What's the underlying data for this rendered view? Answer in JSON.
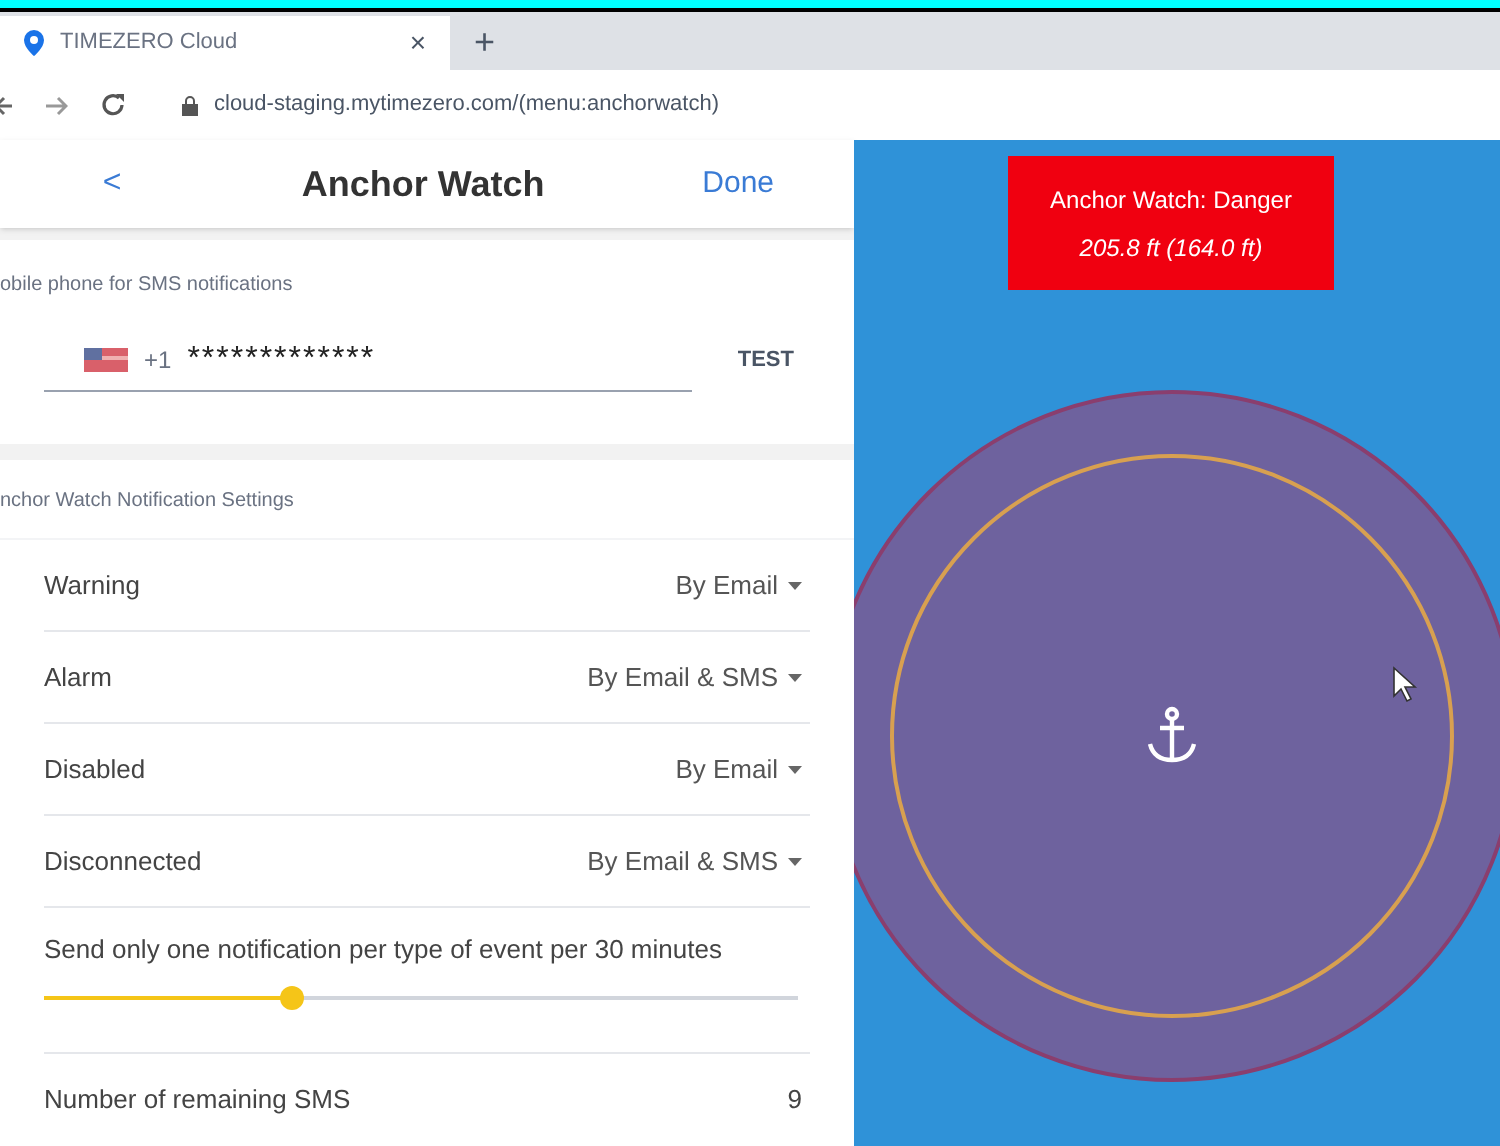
{
  "browser": {
    "tab_title": "TIMEZERO Cloud",
    "tab_close": "×",
    "new_tab": "+",
    "url": "cloud-staging.mytimezero.com/(menu:anchorwatch)"
  },
  "header": {
    "back": "<",
    "title": "Anchor Watch",
    "done": "Done"
  },
  "phone_section": {
    "heading": "obile phone for SMS notifications",
    "country_code": "+1",
    "value": "*************",
    "test_button": "TEST"
  },
  "notification_section": {
    "heading": "nchor Watch Notification Settings",
    "rows": [
      {
        "label": "Warning",
        "value": "By Email"
      },
      {
        "label": "Alarm",
        "value": "By Email & SMS"
      },
      {
        "label": "Disabled",
        "value": "By Email"
      },
      {
        "label": "Disconnected",
        "value": "By Email & SMS"
      }
    ],
    "throttle": {
      "label": "Send only one notification per type of event per 30 minutes",
      "level": 0.33
    },
    "remaining": {
      "label": "Number of remaining SMS",
      "value": "9"
    }
  },
  "map": {
    "alert_title": "Anchor Watch: Danger",
    "alert_distance": "205.8 ft (164.0 ft)"
  }
}
